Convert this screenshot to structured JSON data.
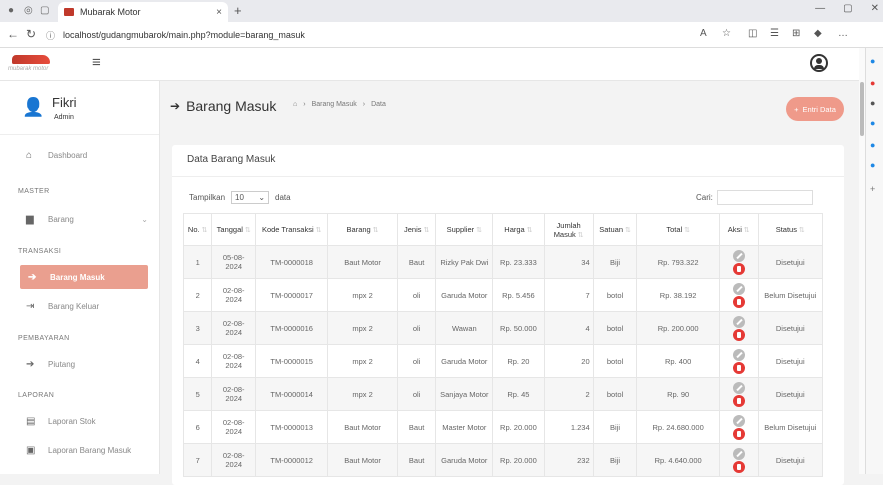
{
  "browser": {
    "tab_title": "Mubarak Motor",
    "tab_close": "×",
    "new_tab": "+",
    "url": "localhost/gudangmubarok/main.php?module=barang_masuk"
  },
  "header": {
    "logo_text": "mubarak motor"
  },
  "profile": {
    "name": "Fikri",
    "role": "Admin"
  },
  "sidebar": {
    "dashboard": "Dashboard",
    "sec_master": "MASTER",
    "barang": "Barang",
    "sec_transaksi": "TRANSAKSI",
    "barang_masuk": "Barang Masuk",
    "barang_keluar": "Barang Keluar",
    "sec_pembayaran": "PEMBAYARAN",
    "piutang": "Piutang",
    "sec_laporan": "LAPORAN",
    "laporan_stok": "Laporan Stok",
    "laporan_barang_masuk": "Laporan Barang Masuk"
  },
  "page": {
    "title": "Barang Masuk",
    "crumb_1": "Barang Masuk",
    "crumb_2": "Data",
    "entri_button": "Entri Data",
    "card_title": "Data Barang Masuk",
    "show_label": "Tampilkan",
    "show_value": "10",
    "show_suffix": "data",
    "search_label": "Cari:"
  },
  "table": {
    "headers": [
      "No.",
      "Tanggal",
      "Kode Transaksi",
      "Barang",
      "Jenis",
      "Supplier",
      "Harga",
      "Jumlah Masuk",
      "Satuan",
      "Total",
      "Aksi",
      "Status"
    ],
    "rows": [
      [
        "1",
        "05-08-2024",
        "TM-0000018",
        "Baut Motor",
        "Baut",
        "Rizky Pak Dwi",
        "Rp. 23.333",
        "34",
        "Biji",
        "Rp. 793.322",
        "Disetujui"
      ],
      [
        "2",
        "02-08-2024",
        "TM-0000017",
        "mpx 2",
        "oli",
        "Garuda Motor",
        "Rp. 5.456",
        "7",
        "botol",
        "Rp. 38.192",
        "Belum Disetujui"
      ],
      [
        "3",
        "02-08-2024",
        "TM-0000016",
        "mpx 2",
        "oli",
        "Wawan",
        "Rp. 50.000",
        "4",
        "botol",
        "Rp. 200.000",
        "Disetujui"
      ],
      [
        "4",
        "02-08-2024",
        "TM-0000015",
        "mpx 2",
        "oli",
        "Garuda Motor",
        "Rp. 20",
        "20",
        "botol",
        "Rp. 400",
        "Disetujui"
      ],
      [
        "5",
        "02-08-2024",
        "TM-0000014",
        "mpx 2",
        "oli",
        "Sanjaya Motor",
        "Rp. 45",
        "2",
        "botol",
        "Rp. 90",
        "Disetujui"
      ],
      [
        "6",
        "02-08-2024",
        "TM-0000013",
        "Baut Motor",
        "Baut",
        "Master Motor",
        "Rp. 20.000",
        "1.234",
        "Biji",
        "Rp. 24.680.000",
        "Belum Disetujui"
      ],
      [
        "7",
        "02-08-2024",
        "TM-0000012",
        "Baut Motor",
        "Baut",
        "Garuda Motor",
        "Rp. 20.000",
        "232",
        "Biji",
        "Rp. 4.640.000",
        "Disetujui"
      ]
    ]
  },
  "colors": {
    "accent": "#ea9f8f",
    "delete": "#e53935"
  }
}
